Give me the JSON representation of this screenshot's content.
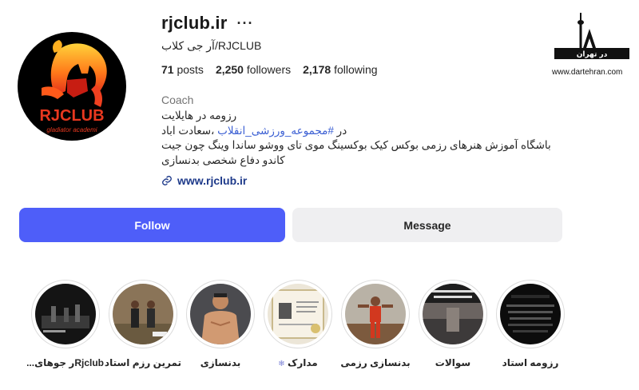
{
  "profile": {
    "username": "rjclub.ir",
    "more_label": "···",
    "full_name": "آر جی کلاب/RJCLUB",
    "category": "Coach",
    "website": "www.rjclub.ir",
    "avatar_text": {
      "brand": "RJCLUB",
      "tagline": "gladiator academi"
    }
  },
  "stats": {
    "posts_count": "71",
    "posts_label": "posts",
    "followers_count": "2,250",
    "followers_label": "followers",
    "following_count": "2,178",
    "following_label": "following"
  },
  "bio": {
    "line1": "رزومه در هایلایت",
    "line2_prefix": "در ",
    "line2_hashtag": "#مجموعه_ورزشی_انقلاب",
    "line2_suffix": " ،سعادت اباد",
    "line3": "باشگاه آموزش هنرهای رزمی بوکس کیک بوکسینگ موی تای ووشو ساندا وینگ چون جیت",
    "line4": "کاندو دفاع شخصی بدنسازی"
  },
  "buttons": {
    "follow": "Follow",
    "message": "Message"
  },
  "watermark": {
    "logo_text": "در تهران",
    "url": "www.dartehran.com"
  },
  "highlights": [
    {
      "label": "رزومه استاد"
    },
    {
      "label": "سوالات"
    },
    {
      "label": "بدنسازی رزمی"
    },
    {
      "label": "مدارک",
      "emoji": "❄"
    },
    {
      "label": "بدنسازی"
    },
    {
      "label": "تمرین رزم استاد"
    },
    {
      "label": "Rjclubر جوهای..."
    }
  ],
  "colors": {
    "follow_button": "#4e5ef9",
    "message_button": "#efeff1",
    "link": "#1e3a8a",
    "hashtag": "#3b5fd3",
    "avatar_accent": "#e8381f"
  }
}
